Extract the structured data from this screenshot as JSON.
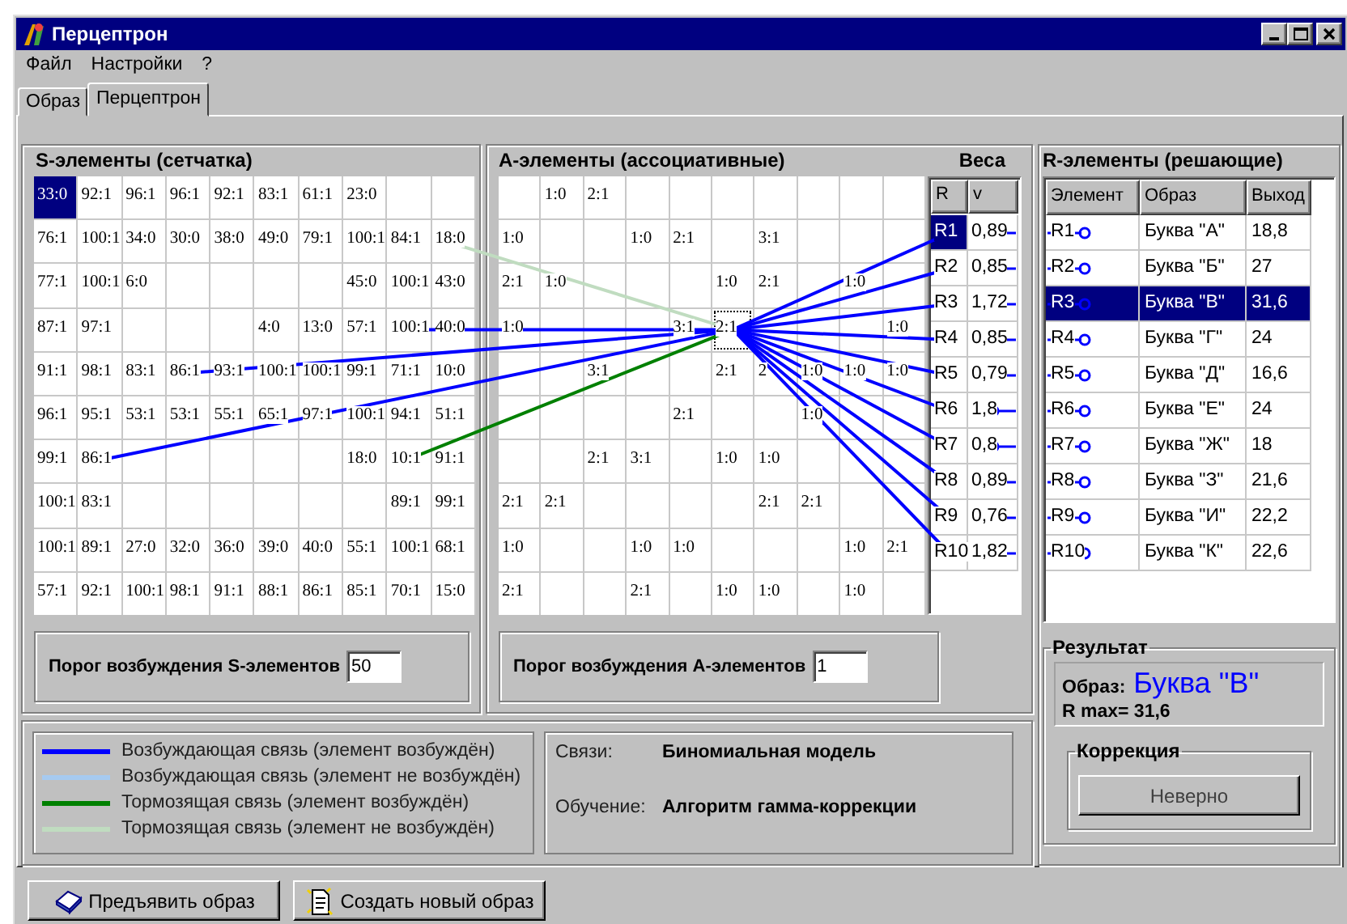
{
  "window": {
    "title": "Перцептрон"
  },
  "menu": [
    "Файл",
    "Настройки",
    "?"
  ],
  "tabs": [
    {
      "label": "Образ",
      "selected": false
    },
    {
      "label": "Перцептрон",
      "selected": true
    }
  ],
  "s_panel": {
    "title": "S-элементы (сетчатка)",
    "rows": [
      [
        {
          "text": "33:0",
          "selected": true
        },
        {
          "text": "92:1",
          "selected": false
        },
        {
          "text": "96:1",
          "selected": false
        },
        {
          "text": "96:1",
          "selected": false
        },
        {
          "text": "92:1",
          "selected": false
        },
        {
          "text": "83:1",
          "selected": false
        },
        {
          "text": "61:1",
          "selected": false
        },
        {
          "text": "23:0",
          "selected": false
        },
        {
          "text": "",
          "selected": false
        },
        {
          "text": "",
          "selected": false
        }
      ],
      [
        {
          "text": "76:1",
          "selected": false
        },
        {
          "text": "100:1",
          "selected": false
        },
        {
          "text": "34:0",
          "selected": false
        },
        {
          "text": "30:0",
          "selected": false
        },
        {
          "text": "38:0",
          "selected": false
        },
        {
          "text": "49:0",
          "selected": false
        },
        {
          "text": "79:1",
          "selected": false
        },
        {
          "text": "100:1",
          "selected": false
        },
        {
          "text": "84:1",
          "selected": false
        },
        {
          "text": "18:0",
          "selected": false
        }
      ],
      [
        {
          "text": "77:1",
          "selected": false
        },
        {
          "text": "100:1",
          "selected": false
        },
        {
          "text": "6:0",
          "selected": false
        },
        {
          "text": "",
          "selected": false
        },
        {
          "text": "",
          "selected": false
        },
        {
          "text": "",
          "selected": false
        },
        {
          "text": "",
          "selected": false
        },
        {
          "text": "45:0",
          "selected": false
        },
        {
          "text": "100:1",
          "selected": false
        },
        {
          "text": "43:0",
          "selected": false
        }
      ],
      [
        {
          "text": "87:1",
          "selected": false
        },
        {
          "text": "97:1",
          "selected": false
        },
        {
          "text": "",
          "selected": false
        },
        {
          "text": "",
          "selected": false
        },
        {
          "text": "",
          "selected": false
        },
        {
          "text": "4:0",
          "selected": false
        },
        {
          "text": "13:0",
          "selected": false
        },
        {
          "text": "57:1",
          "selected": false
        },
        {
          "text": "100:1",
          "selected": false
        },
        {
          "text": "40:0",
          "selected": false
        }
      ],
      [
        {
          "text": "91:1",
          "selected": false
        },
        {
          "text": "98:1",
          "selected": false
        },
        {
          "text": "83:1",
          "selected": false
        },
        {
          "text": "86:1",
          "selected": false
        },
        {
          "text": "93:1",
          "selected": false
        },
        {
          "text": "100:1",
          "selected": false
        },
        {
          "text": "100:1",
          "selected": false
        },
        {
          "text": "99:1",
          "selected": false
        },
        {
          "text": "71:1",
          "selected": false
        },
        {
          "text": "10:0",
          "selected": false
        }
      ],
      [
        {
          "text": "96:1",
          "selected": false
        },
        {
          "text": "95:1",
          "selected": false
        },
        {
          "text": "53:1",
          "selected": false
        },
        {
          "text": "53:1",
          "selected": false
        },
        {
          "text": "55:1",
          "selected": false
        },
        {
          "text": "65:1",
          "selected": false
        },
        {
          "text": "97:1",
          "selected": false
        },
        {
          "text": "100:1",
          "selected": false
        },
        {
          "text": "94:1",
          "selected": false
        },
        {
          "text": "51:1",
          "selected": false
        }
      ],
      [
        {
          "text": "99:1",
          "selected": false
        },
        {
          "text": "86:1",
          "selected": false
        },
        {
          "text": "",
          "selected": false
        },
        {
          "text": "",
          "selected": false
        },
        {
          "text": "",
          "selected": false
        },
        {
          "text": "",
          "selected": false
        },
        {
          "text": "",
          "selected": false
        },
        {
          "text": "18:0",
          "selected": false
        },
        {
          "text": "10:1",
          "selected": false
        },
        {
          "text": "91:1",
          "selected": false
        }
      ],
      [
        {
          "text": "100:1",
          "selected": false
        },
        {
          "text": "83:1",
          "selected": false
        },
        {
          "text": "",
          "selected": false
        },
        {
          "text": "",
          "selected": false
        },
        {
          "text": "",
          "selected": false
        },
        {
          "text": "",
          "selected": false
        },
        {
          "text": "",
          "selected": false
        },
        {
          "text": "",
          "selected": false
        },
        {
          "text": "89:1",
          "selected": false
        },
        {
          "text": "99:1",
          "selected": false
        }
      ],
      [
        {
          "text": "100:1",
          "selected": false
        },
        {
          "text": "89:1",
          "selected": false
        },
        {
          "text": "27:0",
          "selected": false
        },
        {
          "text": "32:0",
          "selected": false
        },
        {
          "text": "36:0",
          "selected": false
        },
        {
          "text": "39:0",
          "selected": false
        },
        {
          "text": "40:0",
          "selected": false
        },
        {
          "text": "55:1",
          "selected": false
        },
        {
          "text": "100:1",
          "selected": false
        },
        {
          "text": "68:1",
          "selected": false
        }
      ],
      [
        {
          "text": "57:1",
          "selected": false
        },
        {
          "text": "92:1",
          "selected": false
        },
        {
          "text": "100:1",
          "selected": false
        },
        {
          "text": "98:1",
          "selected": false
        },
        {
          "text": "91:1",
          "selected": false
        },
        {
          "text": "88:1",
          "selected": false
        },
        {
          "text": "86:1",
          "selected": false
        },
        {
          "text": "85:1",
          "selected": false
        },
        {
          "text": "70:1",
          "selected": false
        },
        {
          "text": "15:0",
          "selected": false
        }
      ]
    ]
  },
  "s_threshold": {
    "label": "Порог возбуждения S-элементов",
    "value": "50"
  },
  "a_panel": {
    "title": "А-элементы (ассоциативные)",
    "rows": [
      [
        {
          "text": "",
          "focused": false
        },
        {
          "text": "1:0",
          "focused": false
        },
        {
          "text": "2:1",
          "focused": false
        },
        {
          "text": "",
          "focused": false
        },
        {
          "text": "",
          "focused": false
        },
        {
          "text": "",
          "focused": false
        },
        {
          "text": "",
          "focused": false
        },
        {
          "text": "",
          "focused": false
        },
        {
          "text": "",
          "focused": false
        },
        {
          "text": "",
          "focused": false
        }
      ],
      [
        {
          "text": "1:0",
          "focused": false
        },
        {
          "text": "",
          "focused": false
        },
        {
          "text": "",
          "focused": false
        },
        {
          "text": "1:0",
          "focused": false
        },
        {
          "text": "2:1",
          "focused": false
        },
        {
          "text": "",
          "focused": false
        },
        {
          "text": "3:1",
          "focused": false
        },
        {
          "text": "",
          "focused": false
        },
        {
          "text": "",
          "focused": false
        },
        {
          "text": "",
          "focused": false
        }
      ],
      [
        {
          "text": "2:1",
          "focused": false
        },
        {
          "text": "1:0",
          "focused": false
        },
        {
          "text": "",
          "focused": false
        },
        {
          "text": "",
          "focused": false
        },
        {
          "text": "",
          "focused": false
        },
        {
          "text": "1:0",
          "focused": false
        },
        {
          "text": "2:1",
          "focused": false
        },
        {
          "text": "",
          "focused": false
        },
        {
          "text": "1:0",
          "focused": false
        },
        {
          "text": "",
          "focused": false
        }
      ],
      [
        {
          "text": "1:0",
          "focused": false
        },
        {
          "text": "",
          "focused": false
        },
        {
          "text": "",
          "focused": false
        },
        {
          "text": "",
          "focused": false
        },
        {
          "text": "3:1",
          "focused": false
        },
        {
          "text": "2:1",
          "focused": true
        },
        {
          "text": "",
          "focused": false
        },
        {
          "text": "",
          "focused": false
        },
        {
          "text": "",
          "focused": false
        },
        {
          "text": "1:0",
          "focused": false
        }
      ],
      [
        {
          "text": "",
          "focused": false
        },
        {
          "text": "",
          "focused": false
        },
        {
          "text": "3:1",
          "focused": false
        },
        {
          "text": "",
          "focused": false
        },
        {
          "text": "",
          "focused": false
        },
        {
          "text": "2:1",
          "focused": false
        },
        {
          "text": "2",
          "focused": false
        },
        {
          "text": "1:0",
          "focused": false
        },
        {
          "text": "1:0",
          "focused": false
        },
        {
          "text": "1:0",
          "focused": false
        }
      ],
      [
        {
          "text": "",
          "focused": false
        },
        {
          "text": "",
          "focused": false
        },
        {
          "text": "",
          "focused": false
        },
        {
          "text": "",
          "focused": false
        },
        {
          "text": "2:1",
          "focused": false
        },
        {
          "text": "",
          "focused": false
        },
        {
          "text": "",
          "focused": false
        },
        {
          "text": "1:0",
          "focused": false
        },
        {
          "text": "",
          "focused": false
        },
        {
          "text": "",
          "focused": false
        }
      ],
      [
        {
          "text": "",
          "focused": false
        },
        {
          "text": "",
          "focused": false
        },
        {
          "text": "2:1",
          "focused": false
        },
        {
          "text": "3:1",
          "focused": false
        },
        {
          "text": "",
          "focused": false
        },
        {
          "text": "1:0",
          "focused": false
        },
        {
          "text": "1:0",
          "focused": false
        },
        {
          "text": "",
          "focused": false
        },
        {
          "text": "",
          "focused": false
        },
        {
          "text": "",
          "focused": false
        }
      ],
      [
        {
          "text": "2:1",
          "focused": false
        },
        {
          "text": "2:1",
          "focused": false
        },
        {
          "text": "",
          "focused": false
        },
        {
          "text": "",
          "focused": false
        },
        {
          "text": "",
          "focused": false
        },
        {
          "text": "",
          "focused": false
        },
        {
          "text": "2:1",
          "focused": false
        },
        {
          "text": "2:1",
          "focused": false
        },
        {
          "text": "",
          "focused": false
        },
        {
          "text": "",
          "focused": false
        }
      ],
      [
        {
          "text": "1:0",
          "focused": false
        },
        {
          "text": "",
          "focused": false
        },
        {
          "text": "",
          "focused": false
        },
        {
          "text": "1:0",
          "focused": false
        },
        {
          "text": "1:0",
          "focused": false
        },
        {
          "text": "",
          "focused": false
        },
        {
          "text": "",
          "focused": false
        },
        {
          "text": "",
          "focused": false
        },
        {
          "text": "1:0",
          "focused": false
        },
        {
          "text": "2:1",
          "focused": false
        }
      ],
      [
        {
          "text": "2:1",
          "focused": false
        },
        {
          "text": "",
          "focused": false
        },
        {
          "text": "",
          "focused": false
        },
        {
          "text": "2:1",
          "focused": false
        },
        {
          "text": "",
          "focused": false
        },
        {
          "text": "1:0",
          "focused": false
        },
        {
          "text": "1:0",
          "focused": false
        },
        {
          "text": "",
          "focused": false
        },
        {
          "text": "1:0",
          "focused": false
        },
        {
          "text": "",
          "focused": false
        }
      ]
    ]
  },
  "weights": {
    "title": "Веса",
    "columns": [
      "R",
      "v"
    ],
    "rows": [
      {
        "r": "R1",
        "v": "0,89",
        "selected": true
      },
      {
        "r": "R2",
        "v": "0,85",
        "selected": false
      },
      {
        "r": "R3",
        "v": "1,72",
        "selected": false
      },
      {
        "r": "R4",
        "v": "0,85",
        "selected": false
      },
      {
        "r": "R5",
        "v": "0,79",
        "selected": false
      },
      {
        "r": "R6",
        "v": "1,8",
        "selected": false
      },
      {
        "r": "R7",
        "v": "0,8",
        "selected": false
      },
      {
        "r": "R8",
        "v": "0,89",
        "selected": false
      },
      {
        "r": "R9",
        "v": "0,76",
        "selected": false
      },
      {
        "r": "R10",
        "v": "1,82",
        "selected": false
      }
    ]
  },
  "a_threshold": {
    "label": "Порог возбуждения А-элементов",
    "value": "1"
  },
  "r_panel": {
    "title": "R-элементы (решающие)",
    "columns": [
      "Элемент",
      "Образ",
      "Выход"
    ],
    "rows": [
      {
        "element": "R1",
        "image": "Буква \"А\"",
        "output": "18,8",
        "selected": false
      },
      {
        "element": "R2",
        "image": "Буква \"Б\"",
        "output": "27",
        "selected": false
      },
      {
        "element": "R3",
        "image": "Буква \"В\"",
        "output": "31,6",
        "selected": true
      },
      {
        "element": "R4",
        "image": "Буква \"Г\"",
        "output": "24",
        "selected": false
      },
      {
        "element": "R5",
        "image": "Буква \"Д\"",
        "output": "16,6",
        "selected": false
      },
      {
        "element": "R6",
        "image": "Буква \"Е\"",
        "output": "24",
        "selected": false
      },
      {
        "element": "R7",
        "image": "Буква \"Ж\"",
        "output": "18",
        "selected": false
      },
      {
        "element": "R8",
        "image": "Буква \"З\"",
        "output": "21,6",
        "selected": false
      },
      {
        "element": "R9",
        "image": "Буква \"И\"",
        "output": "22,2",
        "selected": false
      },
      {
        "element": "R10",
        "image": "Буква \"К\"",
        "output": "22,6",
        "selected": false
      }
    ]
  },
  "result": {
    "title": "Результат",
    "image_label": "Образ:",
    "image_value": "Буква \"В\"",
    "rmax": "R max= 31,6"
  },
  "correction": {
    "title": "Коррекция",
    "button": "Неверно"
  },
  "legend": [
    {
      "label": "Возбуждающая связь (элемент возбуждён)",
      "color": "#0000ff"
    },
    {
      "label": "Возбуждающая связь (элемент не возбуждён)",
      "color": "#a6caf0"
    },
    {
      "label": "Тормозящая связь (элемент возбуждён)",
      "color": "#008000"
    },
    {
      "label": "Тормозящая связь (элемент не возбуждён)",
      "color": "#c0dcc0"
    }
  ],
  "info": [
    {
      "label": "Связи:",
      "value": "Биномиальная модель"
    },
    {
      "label": "Обучение:",
      "value": "Алгоритм гамма-коррекции"
    }
  ],
  "buttons": [
    {
      "label": "Предъявить образ",
      "kind": "book"
    },
    {
      "label": "Создать новый образ",
      "kind": "page"
    }
  ]
}
